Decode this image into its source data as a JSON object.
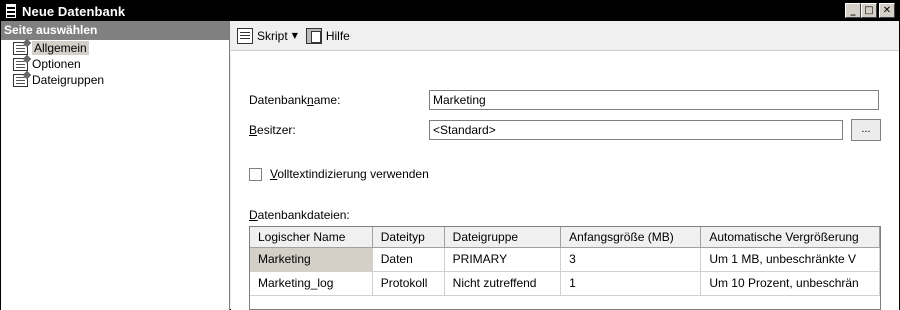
{
  "window": {
    "title": "Neue Datenbank",
    "controls": {
      "minimize": "_",
      "maximize": "□",
      "close": "✕"
    }
  },
  "sidebar": {
    "header": "Seite auswählen",
    "items": [
      {
        "label": "Allgemein",
        "icon": "page-icon",
        "selected": true
      },
      {
        "label": "Optionen",
        "icon": "page-icon",
        "selected": false
      },
      {
        "label": "Dateigruppen",
        "icon": "page-icon",
        "selected": false
      }
    ]
  },
  "toolbar": {
    "script_label": "Skript",
    "script_caret": "▼",
    "help_label": "Hilfe"
  },
  "form": {
    "dbname_label_pre": "Datenbank",
    "dbname_label_u": "n",
    "dbname_label_post": "ame:",
    "dbname_value": "Marketing",
    "owner_label_u": "B",
    "owner_label_post": "esitzer:",
    "owner_value": "<Standard>",
    "browse_label": "...",
    "fulltext_label_u": "V",
    "fulltext_label_post": "olltextindizierung verwenden",
    "fulltext_checked": false,
    "files_label_u": "D",
    "files_label_post": "atenbankdateien:"
  },
  "files_table": {
    "columns": [
      "Logischer Name",
      "Dateityp",
      "Dateigruppe",
      "Anfangsgröße (MB)",
      "Automatische Vergrößerung"
    ],
    "rows": [
      [
        "Marketing",
        "Daten",
        "PRIMARY",
        "3",
        "Um 1 MB, unbeschränkte V"
      ],
      [
        "Marketing_log",
        "Protokoll",
        "Nicht zutreffend",
        "1",
        "Um 10 Prozent, unbeschrän"
      ]
    ]
  }
}
